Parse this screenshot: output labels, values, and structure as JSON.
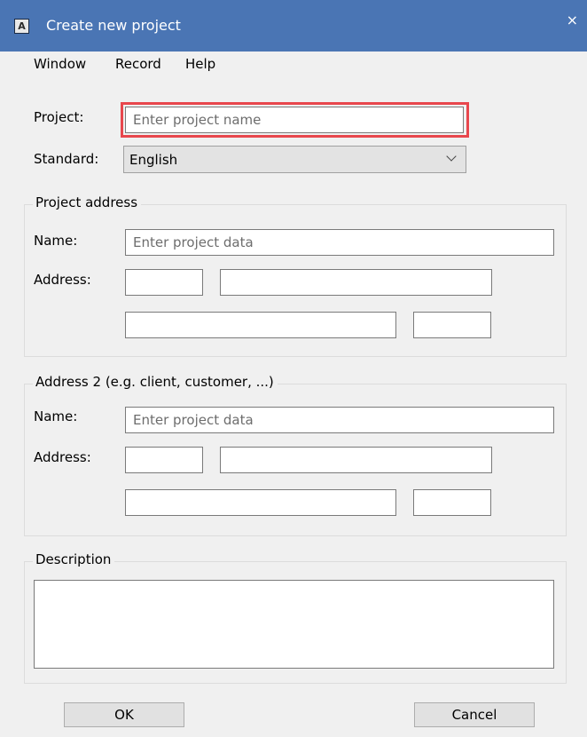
{
  "window": {
    "title": "Create new project",
    "app_icon": "A",
    "close": "×"
  },
  "menu": {
    "items": [
      "Window",
      "Record",
      "Help"
    ]
  },
  "project": {
    "label": "Project:",
    "placeholder": "Enter project name",
    "value": ""
  },
  "standard": {
    "label": "Standard:",
    "value": "English"
  },
  "project_address": {
    "legend": "Project address",
    "name_label": "Name:",
    "name_placeholder": "Enter project data",
    "address_label": "Address:"
  },
  "address2": {
    "legend": "Address 2 (e.g. client, customer, ...)",
    "name_label": "Name:",
    "name_placeholder": "Enter project data",
    "address_label": "Address:"
  },
  "description": {
    "legend": "Description",
    "value": ""
  },
  "buttons": {
    "ok": "OK",
    "cancel": "Cancel"
  },
  "colors": {
    "titlebar": "#4a75b4",
    "highlight": "#e8474d",
    "background": "#f0f0f0"
  },
  "icons": {
    "close": "close-icon",
    "dropdown": "chevron-down-icon",
    "app": "app-icon"
  }
}
